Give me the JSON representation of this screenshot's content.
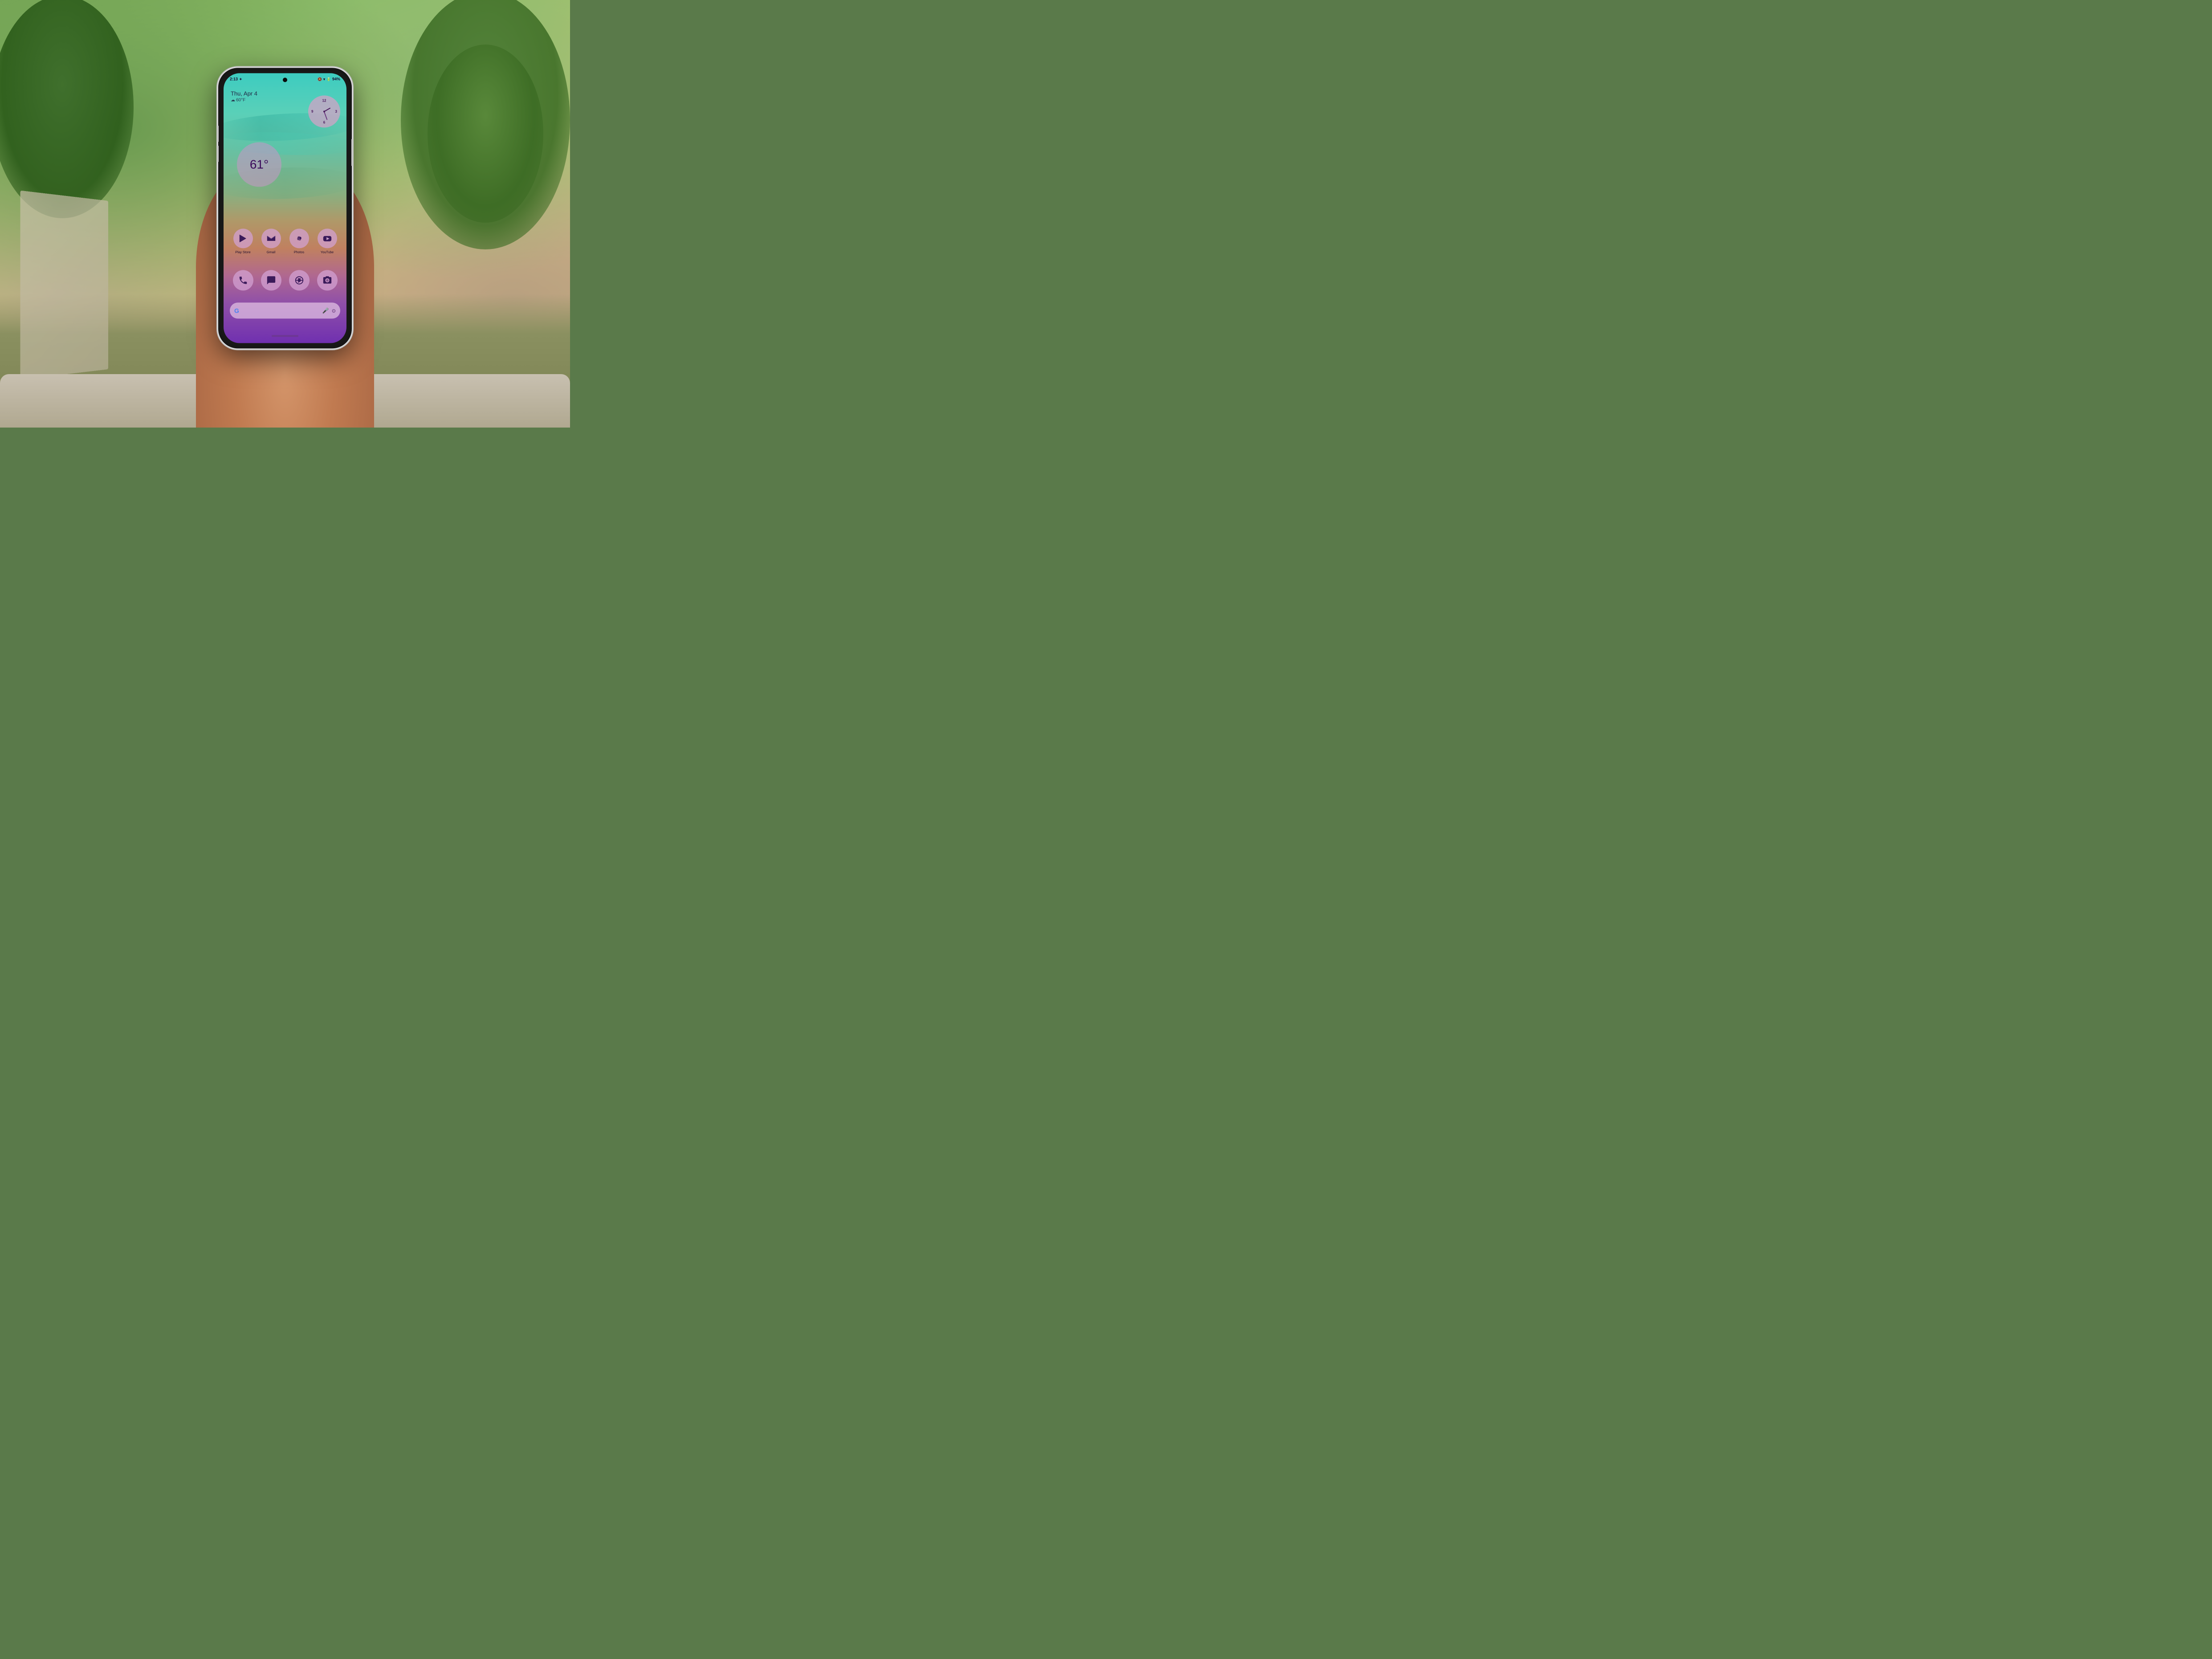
{
  "background": {
    "description": "Outdoor park scene with trees and grass"
  },
  "phone": {
    "status_bar": {
      "time": "2:13",
      "battery": "94%",
      "signal_icon": "signal",
      "wifi_icon": "wifi",
      "mute_icon": "mute"
    },
    "date_weather": {
      "date": "Thu, Apr 4",
      "weather": "60°F",
      "weather_icon": "cloud"
    },
    "clock_widget": {
      "label": "clock"
    },
    "weather_bubble": {
      "temperature": "61°"
    },
    "apps": [
      {
        "id": "play-store",
        "label": "Play Store",
        "icon": "play-store-icon"
      },
      {
        "id": "gmail",
        "label": "Gmail",
        "icon": "gmail-icon"
      },
      {
        "id": "photos",
        "label": "Photos",
        "icon": "photos-icon"
      },
      {
        "id": "youtube",
        "label": "YouTube",
        "icon": "youtube-icon"
      }
    ],
    "dock": [
      {
        "id": "phone",
        "label": "Phone",
        "icon": "phone-icon"
      },
      {
        "id": "messages",
        "label": "Messages",
        "icon": "messages-icon"
      },
      {
        "id": "chrome",
        "label": "Chrome",
        "icon": "chrome-icon"
      },
      {
        "id": "camera",
        "label": "Camera",
        "icon": "camera-icon"
      }
    ],
    "search_bar": {
      "google_logo": "G",
      "mic_label": "mic",
      "lens_label": "lens"
    }
  }
}
